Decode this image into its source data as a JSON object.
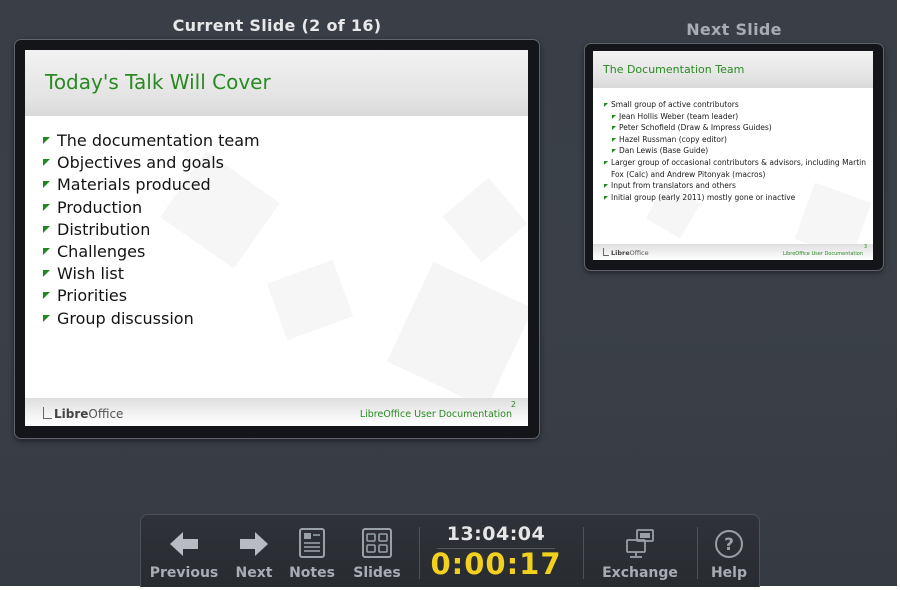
{
  "current": {
    "heading": "Current Slide (2 of 16)",
    "title": "Today's Talk Will Cover",
    "bullets": [
      "The documentation team",
      "Objectives and goals",
      "Materials produced",
      "Production",
      "Distribution",
      "Challenges",
      "Wish list",
      "Priorities",
      "Group discussion"
    ],
    "footer_logo_pre": "Libre",
    "footer_logo_post": "Office",
    "footer_doc": "LibreOffice User Documentation",
    "slide_number": "2"
  },
  "next": {
    "heading": "Next Slide",
    "title": "The Documentation Team",
    "bullets": [
      {
        "text": "Small group of active contributors",
        "level": 1
      },
      {
        "text": "Jean Hollis Weber (team leader)",
        "level": 2
      },
      {
        "text": "Peter Schofield (Draw & Impress Guides)",
        "level": 2
      },
      {
        "text": "Hazel Russman (copy editor)",
        "level": 2
      },
      {
        "text": "Dan Lewis (Base Guide)",
        "level": 2
      },
      {
        "text": "Larger group of occasional contributors & advisors, including Martin Fox (Calc) and Andrew Pitonyak (macros)",
        "level": 1
      },
      {
        "text": "Input from translators and others",
        "level": 1
      },
      {
        "text": "Initial group (early 2011) mostly gone or inactive",
        "level": 1
      }
    ],
    "footer_logo_pre": "Libre",
    "footer_logo_post": "Office",
    "footer_doc": "LibreOffice User Documentation",
    "slide_number": "3"
  },
  "toolbar": {
    "previous": "Previous",
    "next": "Next",
    "notes": "Notes",
    "slides": "Slides",
    "clock": "13:04:04",
    "timer": "0:00:17",
    "exchange": "Exchange",
    "help": "Help",
    "timer_color": "#f2d11e",
    "icons": {
      "previous": "arrow-left-icon",
      "next": "arrow-right-icon",
      "notes": "notes-icon",
      "slides": "slides-grid-icon",
      "exchange": "monitor-exchange-icon",
      "help": "question-circle-icon"
    }
  },
  "colors": {
    "background": "#3a3f47",
    "title_green": "#2a8a22",
    "bullet_green": "#1e8a1e"
  }
}
